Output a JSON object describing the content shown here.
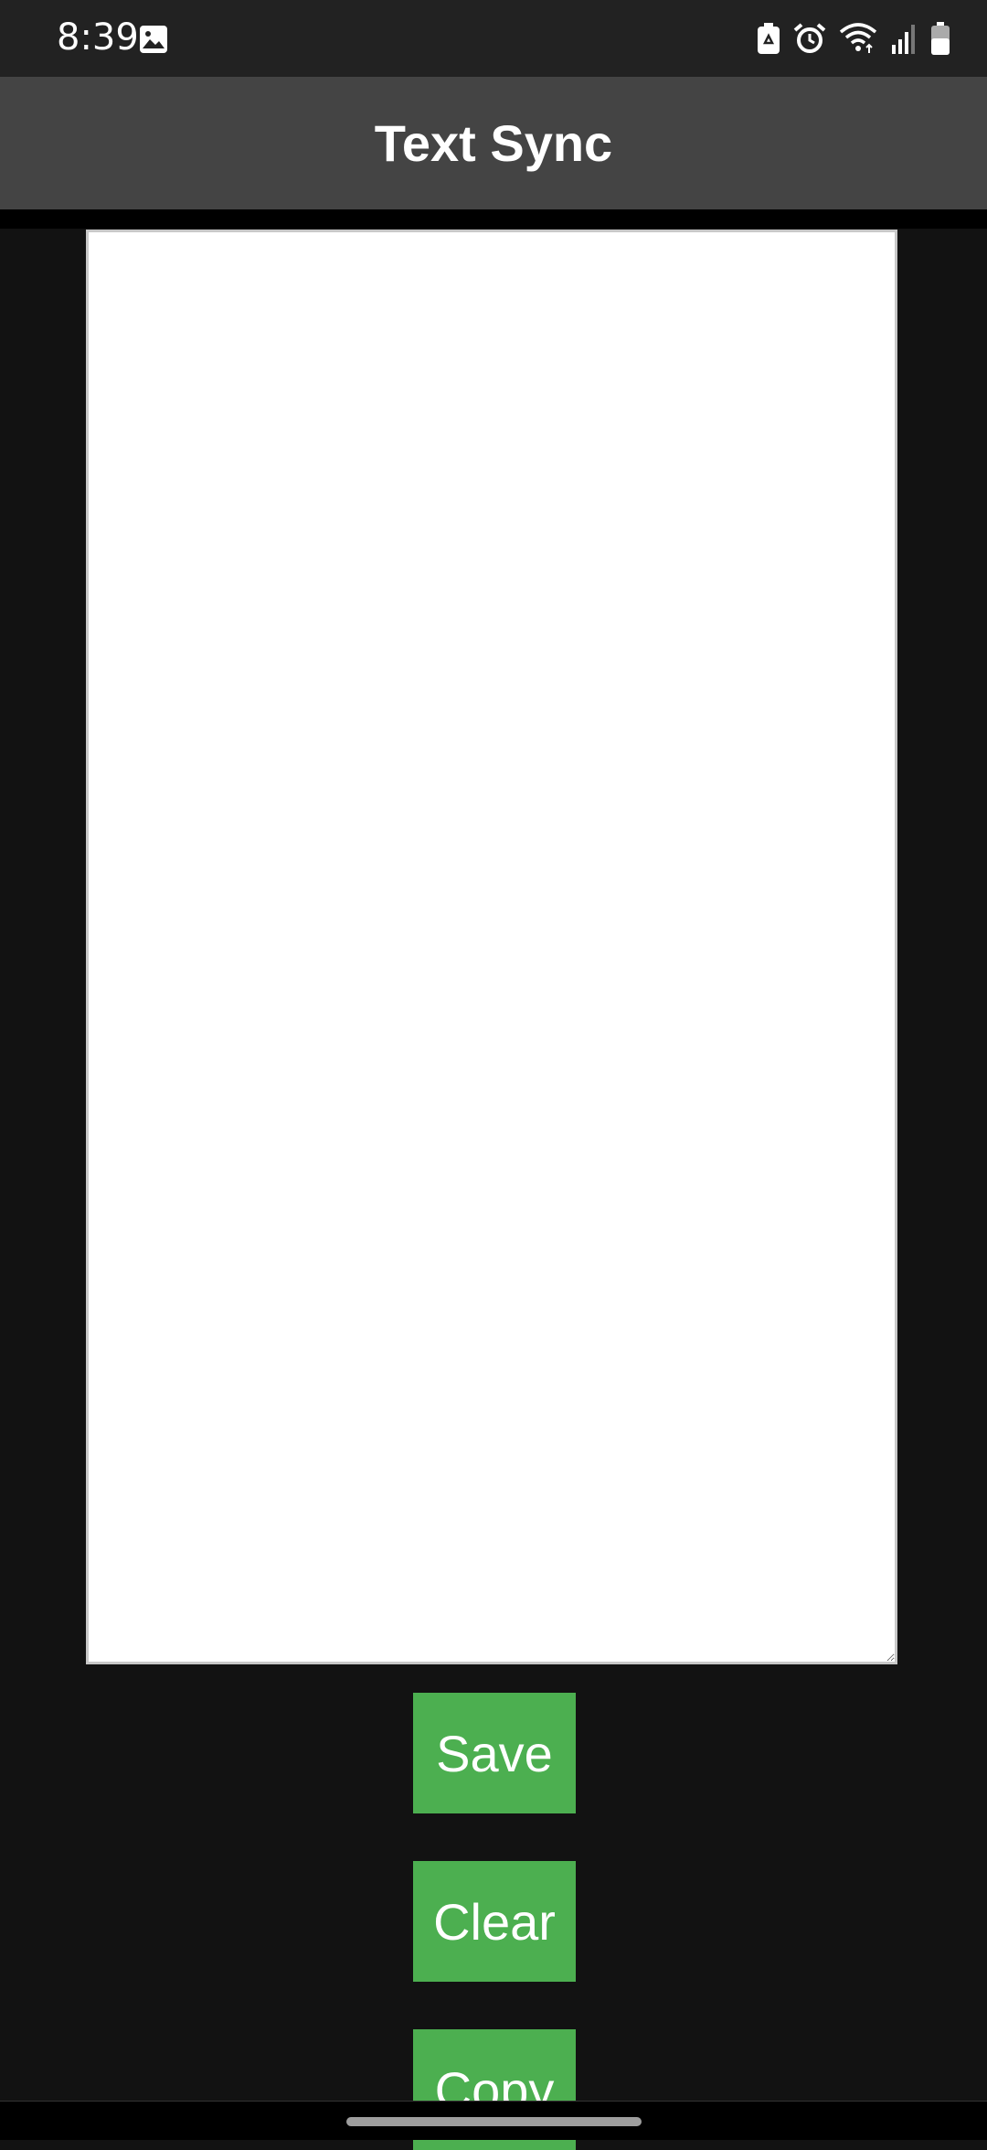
{
  "status_bar": {
    "time": "8:39",
    "left_icons": [
      "gallery-icon"
    ],
    "right_icons": [
      "battery-saver-icon",
      "alarm-icon",
      "wifi-icon",
      "signal-icon",
      "battery-icon"
    ]
  },
  "app_bar": {
    "title": "Text Sync"
  },
  "editor": {
    "value": "",
    "placeholder": ""
  },
  "buttons": {
    "save_label": "Save",
    "clear_label": "Clear",
    "copy_label": "Copy"
  },
  "colors": {
    "status_bar": "#222222",
    "app_bar": "#444444",
    "background": "#121212",
    "button": "#4caf50",
    "text_area": "#ffffff"
  }
}
